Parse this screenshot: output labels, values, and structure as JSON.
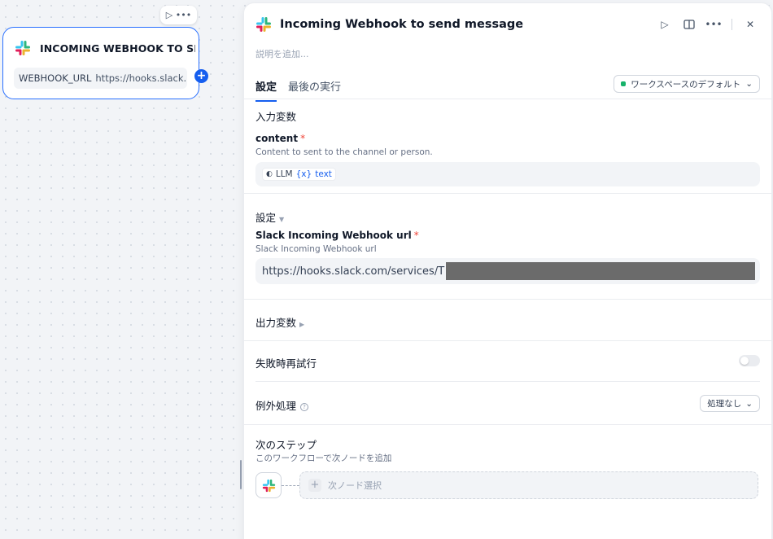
{
  "canvas": {
    "node": {
      "title": "INCOMING WEBHOOK TO SEN",
      "var_key": "WEBHOOK_URL",
      "var_value": "https://hooks.slack...."
    }
  },
  "panel": {
    "title": "Incoming Webhook to send message",
    "description_placeholder": "説明を追加...",
    "tabs": [
      {
        "label": "設定"
      },
      {
        "label": "最後の実行"
      }
    ],
    "workspace_select": "ワークスペースのデフォルト",
    "input_vars_title": "入力変数",
    "content_field": {
      "label": "content",
      "required_mark": "*",
      "help": "Content to sent to the channel or person.",
      "chip_source": "LLM",
      "chip_var_prefix": "{x}",
      "chip_var": "text"
    },
    "settings_title": "設定",
    "url_field": {
      "label": "Slack Incoming Webhook url",
      "required_mark": "*",
      "help": "Slack Incoming Webhook url",
      "value": "https://hooks.slack.com/services/T"
    },
    "output_vars_title": "出力変数",
    "retry_title": "失敗時再試行",
    "exception_title": "例外処理",
    "exception_select": "処理なし",
    "next_step": {
      "title": "次のステップ",
      "help": "このワークフローで次ノードを追加",
      "select_placeholder": "次ノード選択"
    }
  }
}
